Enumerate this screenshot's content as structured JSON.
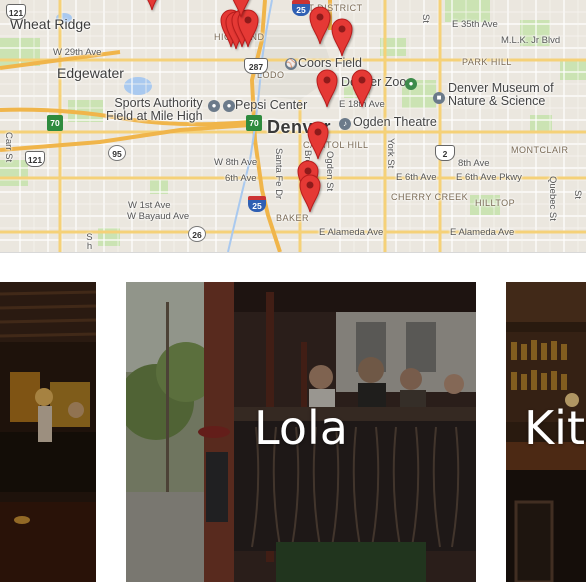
{
  "map": {
    "cities": {
      "wheat_ridge": "Wheat Ridge",
      "edgewater": "Edgewater",
      "denver": "Denver"
    },
    "pois": {
      "coors_field": "Coors Field",
      "denver_zoo": "Denver Zoo",
      "museum": "Denver Museum of\nNature & Science",
      "sports_authority": "Sports Authority\nField at Mile High",
      "pepsi_center": "Pepsi Center",
      "ogden_theatre": "Ogden Theatre"
    },
    "streets": {
      "w29th": "W 29th Ave",
      "e35th": "E 35th Ave",
      "mlk": "M.L.K. Jr Blvd",
      "e18th": "E 18th Ave",
      "w8th": "W 8th Ave",
      "sixth": "6th Ave",
      "e6th": "E 6th Ave",
      "eighth": "8th Ave",
      "e6thpkwy": "E 6th Ave Pkwy",
      "w1st": "W 1st Ave",
      "wbayaud": "W Bayaud Ave",
      "ealameda": "E Alameda Ave",
      "ealameda2": "E Alameda Ave",
      "cherry_creek": "CHERRY CREEK",
      "carr": "Carr St",
      "santa_fe": "Santa Fe Dr",
      "york": "York St",
      "quebec": "Quebec St",
      "ogden": "Ogden St",
      "broadway": "Broadway",
      "sh": "Sh",
      "st_top": "St",
      "st_right": "St"
    },
    "neighborhoods": {
      "art_district": "ART DISTRICT",
      "highland": "HIGHLAND",
      "lodo": "LODO",
      "park_hill": "PARK HILL",
      "capitol_hill": "CAPITOL HILL",
      "montclair": "MONTCLAIR",
      "hilltop": "HILLTOP",
      "baker": "BAKER"
    },
    "shields": {
      "us121a": "121",
      "us121b": "121",
      "s70a": "70",
      "s70b": "70",
      "us95": "95",
      "s26": "26",
      "i25": "25",
      "us2": "2",
      "i25b": "25",
      "us287": "287"
    },
    "colors": {
      "pin": "#e53935",
      "pin_dot": "#8e1b1b",
      "park": "#c8dfb0",
      "water": "#a6c8f0",
      "road": "#ffffff",
      "highway": "#f6d37a"
    }
  },
  "cards": [
    {
      "title": ""
    },
    {
      "title": "Lola"
    },
    {
      "title": "Kitchen"
    }
  ]
}
